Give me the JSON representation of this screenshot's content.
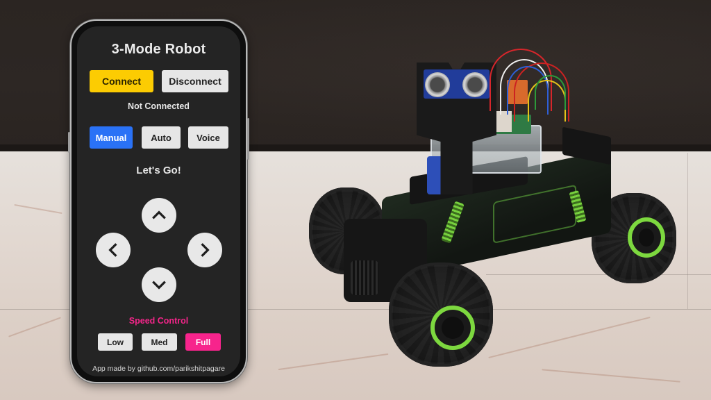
{
  "app": {
    "title": "3-Mode Robot",
    "connection": {
      "connect_label": "Connect",
      "disconnect_label": "Disconnect",
      "status_text": "Not Connected"
    },
    "modes": [
      {
        "label": "Manual",
        "selected": true
      },
      {
        "label": "Auto",
        "selected": false
      },
      {
        "label": "Voice",
        "selected": false
      }
    ],
    "prompt_text": "Let's Go!",
    "dpad": {
      "up_icon": "chevron-up-icon",
      "left_icon": "chevron-left-icon",
      "right_icon": "chevron-right-icon",
      "down_icon": "chevron-down-icon"
    },
    "speed": {
      "label": "Speed Control",
      "options": [
        {
          "label": "Low",
          "selected": false
        },
        {
          "label": "Med",
          "selected": false
        },
        {
          "label": "Full",
          "selected": true
        }
      ]
    },
    "footer_text": "App made by github.com/parikshitpagare"
  },
  "colors": {
    "screen_bg": "#242424",
    "connect_yellow": "#fccc02",
    "manual_blue": "#2a72f6",
    "speed_pink": "#f7248c",
    "neutral_button": "#e6e6e6",
    "wheel_rim_green": "#7dd83f"
  },
  "photo": {
    "subject": "RC rock-crawler robot car with ultrasonic sensor, Arduino board and servo on marble floor"
  }
}
